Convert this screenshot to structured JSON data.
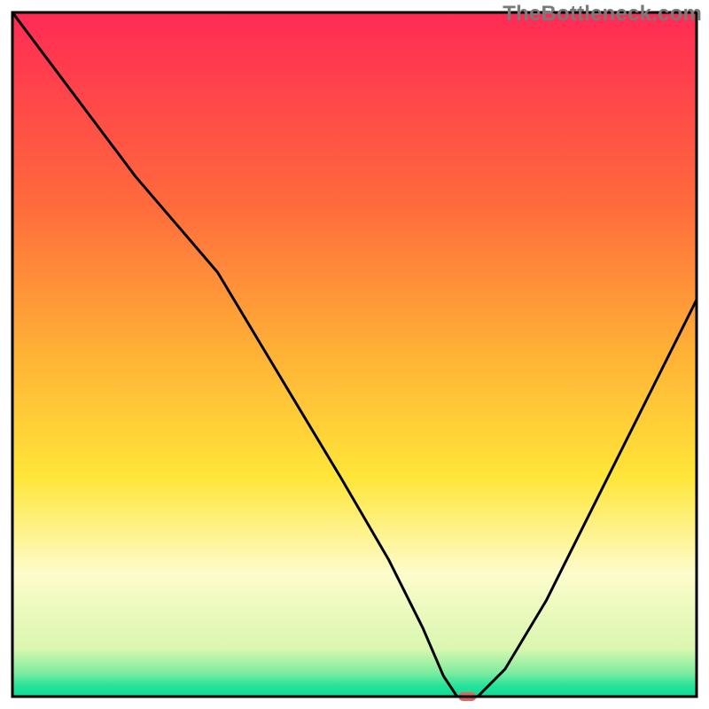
{
  "watermark": "TheBottleneck.com",
  "chart_data": {
    "type": "line",
    "title": "",
    "xlabel": "",
    "ylabel": "",
    "xlim": [
      0,
      100
    ],
    "ylim": [
      0,
      100
    ],
    "grid": false,
    "legend": false,
    "background_gradient_stops": [
      {
        "offset": 0,
        "color": "#ff2a55"
      },
      {
        "offset": 0.28,
        "color": "#ff6a3c"
      },
      {
        "offset": 0.5,
        "color": "#ffb236"
      },
      {
        "offset": 0.68,
        "color": "#ffe639"
      },
      {
        "offset": 0.82,
        "color": "#fdfccb"
      },
      {
        "offset": 0.93,
        "color": "#d9f7b0"
      },
      {
        "offset": 0.965,
        "color": "#7eec9f"
      },
      {
        "offset": 0.985,
        "color": "#24e29a"
      },
      {
        "offset": 1.0,
        "color": "#10db98"
      }
    ],
    "series": [
      {
        "name": "bottleneck-curve",
        "x": [
          0,
          6,
          12,
          18,
          24,
          30,
          36,
          42,
          48,
          55,
          60,
          63,
          65,
          68,
          72,
          78,
          85,
          92,
          100
        ],
        "y": [
          100,
          92,
          84,
          76,
          69,
          62,
          52,
          42,
          32,
          20,
          10,
          3,
          0,
          0,
          4,
          14,
          28,
          42,
          58
        ]
      }
    ],
    "marker": {
      "name": "optimal-zone",
      "x": 66.5,
      "y": 0,
      "color": "#e06666",
      "rx": 10,
      "ry": 5
    },
    "axes": {
      "border_color": "#000000",
      "border_width": 3
    }
  }
}
